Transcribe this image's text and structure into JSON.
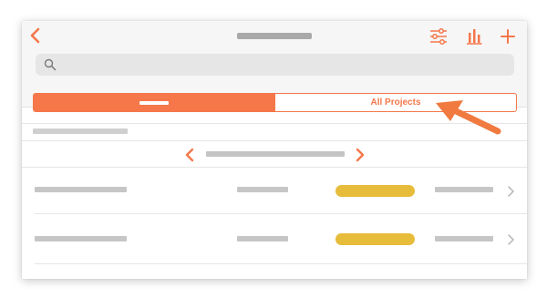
{
  "colors": {
    "accent": "#f5774a",
    "status_pill": "#e7bc3b",
    "placeholder_gray": "#c6c6c6",
    "header_bg": "#f6f6f6",
    "search_bg": "#e6e6e6"
  },
  "header": {
    "icons": [
      "chevron-left-icon",
      "sliders-icon",
      "bar-chart-icon",
      "plus-icon"
    ]
  },
  "search": {
    "icon": "search-icon",
    "placeholder": ""
  },
  "tabs": {
    "right_label": "All Projects"
  },
  "pager": {
    "icons": [
      "chevron-left-icon",
      "chevron-right-icon"
    ]
  },
  "rows": {
    "count": 2,
    "trailing_icon": "chevron-right-icon"
  }
}
